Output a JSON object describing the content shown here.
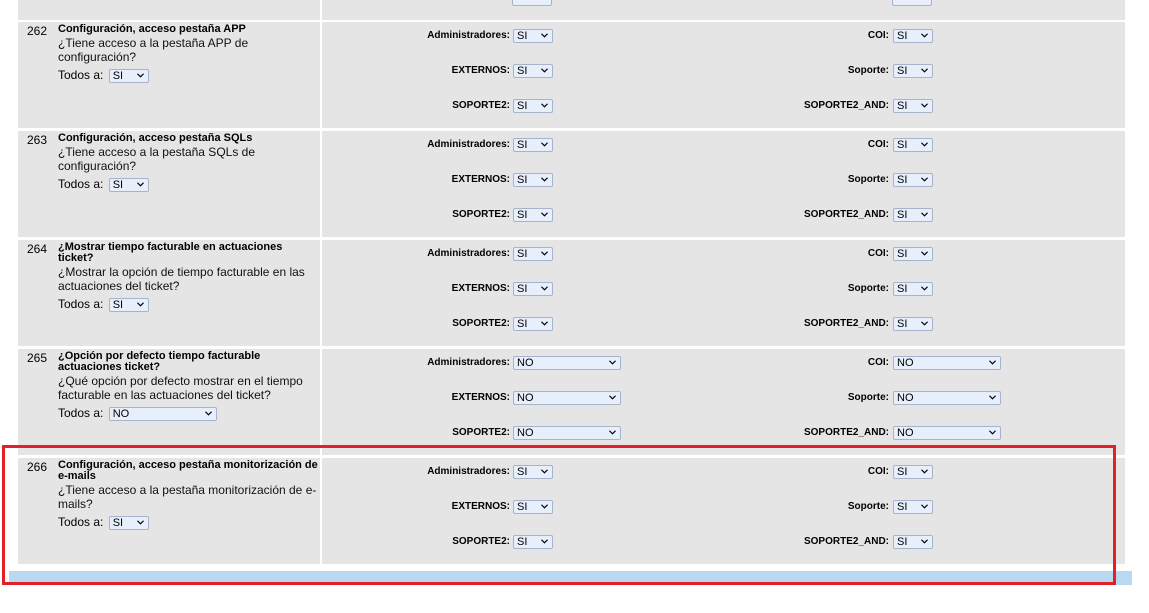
{
  "rows": [
    {
      "number": "262",
      "title": "Configuración, acceso pestaña APP",
      "description": "¿Tiene acceso a la pestaña APP de configuración?",
      "todos_label": "Todos a:",
      "todos_value": "SI",
      "fields": {
        "administradores": {
          "label": "Administradores:",
          "value": "SI"
        },
        "coi": {
          "label": "COI:",
          "value": "SI"
        },
        "externos": {
          "label": "EXTERNOS:",
          "value": "SI"
        },
        "soporte": {
          "label": "Soporte:",
          "value": "SI"
        },
        "soporte2": {
          "label": "SOPORTE2:",
          "value": "SI"
        },
        "soporte2_and": {
          "label": "SOPORTE2_AND:",
          "value": "SI"
        }
      }
    },
    {
      "number": "263",
      "title": "Configuración, acceso pestaña SQLs",
      "description": "¿Tiene acceso a la pestaña SQLs de configuración?",
      "todos_label": "Todos a:",
      "todos_value": "SI",
      "fields": {
        "administradores": {
          "label": "Administradores:",
          "value": "SI"
        },
        "coi": {
          "label": "COI:",
          "value": "SI"
        },
        "externos": {
          "label": "EXTERNOS:",
          "value": "SI"
        },
        "soporte": {
          "label": "Soporte:",
          "value": "SI"
        },
        "soporte2": {
          "label": "SOPORTE2:",
          "value": "SI"
        },
        "soporte2_and": {
          "label": "SOPORTE2_AND:",
          "value": "SI"
        }
      }
    },
    {
      "number": "264",
      "title": "¿Mostrar tiempo facturable en actuaciones ticket?",
      "description": "¿Mostrar la opción de tiempo facturable en las actuaciones del ticket?",
      "todos_label": "Todos a:",
      "todos_value": "SI",
      "fields": {
        "administradores": {
          "label": "Administradores:",
          "value": "SI"
        },
        "coi": {
          "label": "COI:",
          "value": "SI"
        },
        "externos": {
          "label": "EXTERNOS:",
          "value": "SI"
        },
        "soporte": {
          "label": "Soporte:",
          "value": "SI"
        },
        "soporte2": {
          "label": "SOPORTE2:",
          "value": "SI"
        },
        "soporte2_and": {
          "label": "SOPORTE2_AND:",
          "value": "SI"
        }
      }
    },
    {
      "number": "265",
      "title": "¿Opción por defecto tiempo facturable actuaciones ticket?",
      "description": "¿Qué opción por defecto mostrar en el tiempo facturable en las actuaciones del ticket?",
      "todos_label": "Todos a:",
      "todos_value": "NO",
      "fields": {
        "administradores": {
          "label": "Administradores:",
          "value": "NO"
        },
        "coi": {
          "label": "COI:",
          "value": "NO"
        },
        "externos": {
          "label": "EXTERNOS:",
          "value": "NO"
        },
        "soporte": {
          "label": "Soporte:",
          "value": "NO"
        },
        "soporte2": {
          "label": "SOPORTE2:",
          "value": "NO"
        },
        "soporte2_and": {
          "label": "SOPORTE2_AND:",
          "value": "NO"
        }
      }
    },
    {
      "number": "266",
      "title": "Configuración, acceso pestaña monitorización de e-mails",
      "description": "¿Tiene acceso a la pestaña monitorización de e-mails?",
      "todos_label": "Todos a:",
      "todos_value": "SI",
      "fields": {
        "administradores": {
          "label": "Administradores:",
          "value": "SI"
        },
        "coi": {
          "label": "COI:",
          "value": "SI"
        },
        "externos": {
          "label": "EXTERNOS:",
          "value": "SI"
        },
        "soporte": {
          "label": "Soporte:",
          "value": "SI"
        },
        "soporte2": {
          "label": "SOPORTE2:",
          "value": "SI"
        },
        "soporte2_and": {
          "label": "SOPORTE2_AND:",
          "value": "SI"
        }
      }
    }
  ],
  "colors": {
    "row_background": "#e5e5e5",
    "select_background": "#e7eefc",
    "highlight_border": "#e3202a",
    "bottom_bar": "#b9d9f3"
  },
  "icons": {
    "select_arrow": "chevron-down-icon"
  }
}
